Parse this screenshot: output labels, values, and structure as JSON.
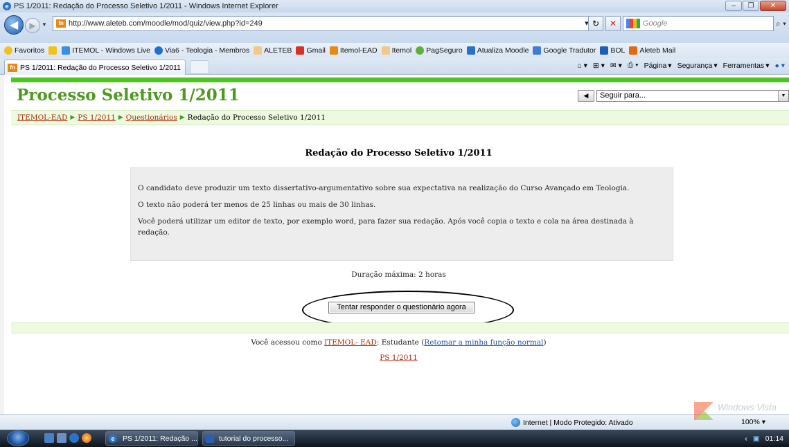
{
  "window": {
    "title": "PS 1/2011: Redação do Processo Seletivo 1/2011 - Windows Internet Explorer"
  },
  "address": {
    "url": "http://www.aleteb.com/moodle/mod/quiz/view.php?id=249",
    "search_placeholder": "Google"
  },
  "favorites": {
    "label": "Favoritos",
    "items": [
      "ITEMOL - Windows Live",
      "Via6 - Teologia - Membros",
      "ALETEB",
      "Gmail",
      "Itemol-EAD",
      "Itemol",
      "PagSeguro",
      "Atualiza Moodle",
      "Google Tradutor",
      "BOL",
      "Aleteb Mail"
    ]
  },
  "tabs": {
    "active": "PS 1/2011: Redação do Processo Seletivo 1/2011"
  },
  "commands": {
    "page": "Página",
    "security": "Segurança",
    "tools": "Ferramentas"
  },
  "page": {
    "heading": "Processo Seletivo 1/2011",
    "jump_placeholder": "Seguir para...",
    "breadcrumb": [
      "ITEMOL-EAD",
      "PS 1/2011",
      "Questionários",
      "Redação do Processo Seletivo 1/2011"
    ],
    "quiz_title": "Redação do Processo Seletivo 1/2011",
    "intro": [
      "O candidato deve produzir um texto dissertativo-argumentativo sobre sua expectativa na realização do Curso Avançado em Teologia.",
      "O texto não poderá ter menos de 25 linhas ou mais de 30 linhas.",
      "Você poderá utilizar um editor de texto, por exemplo word, para fazer sua redação. Após você copia o texto e cola na área destinada à redação."
    ],
    "duration": "Duração máxima: 2 horas",
    "start_button": "Tentar responder o questionário agora",
    "login_prefix": "Você acessou como ",
    "login_user": "ITEMOL- EAD",
    "login_role": ": Estudante (",
    "login_return": "Retomar a minha função normal",
    "login_suffix": ")",
    "home_link": "PS 1/2011"
  },
  "status": {
    "zone": "Internet | Modo Protegido: Ativado",
    "zoom": "100%"
  },
  "taskbar": {
    "items": [
      "PS 1/2011: Redação ...",
      "tutorial do processo..."
    ],
    "clock": "01:14"
  },
  "watermark": {
    "text": "Windows Vista"
  }
}
